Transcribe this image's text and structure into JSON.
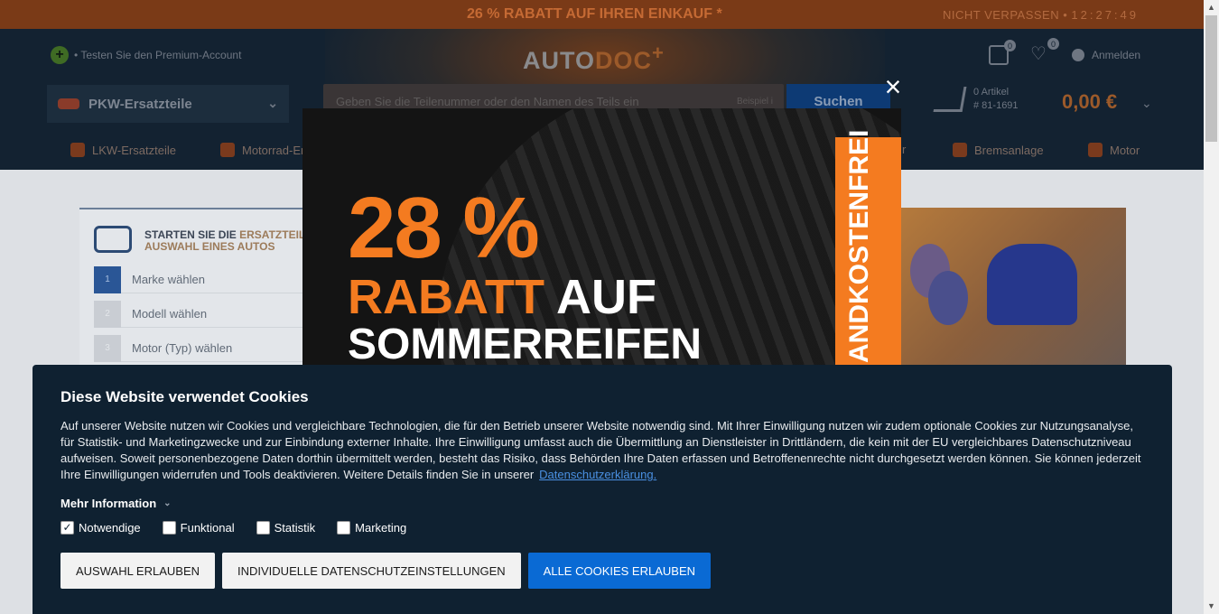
{
  "topbar": {
    "promo": "26 % RABATT AUF IHREN EINKAUF *",
    "countdown_label": "NICHT VERPASSEN",
    "countdown": "12:27:49"
  },
  "header": {
    "premium": "• Testen Sie den Premium-Account",
    "logo_main": "AUTO",
    "logo_accent": "DOC",
    "logo_plus": "+",
    "badge_garage": "0",
    "badge_wishlist": "0",
    "login": "Anmelden",
    "category": "PKW-Ersatzteile",
    "search_placeholder": "Geben Sie die Teilenummer oder den Namen des Teils ein",
    "search_example": "Beispiel",
    "search_button": "Suchen",
    "cart_count": "0 Artikel",
    "cart_id": "# 81-1691",
    "cart_total": "0,00 €"
  },
  "nav": {
    "truck": "LKW-Ersatzteile",
    "moto": "Motorrad-Er",
    "filter": "r",
    "brakes": "Bremsanlage",
    "engine": "Motor"
  },
  "panel": {
    "title_a": "STARTEN SIE DIE ",
    "title_b": "ERSATZTEIL",
    "title_c": "AUSWAHL EINES AUTOS",
    "steps": [
      {
        "num": "1",
        "label": "Marke wählen"
      },
      {
        "num": "2",
        "label": "Modell wählen"
      },
      {
        "num": "3",
        "label": "Motor (Typ) wählen"
      }
    ]
  },
  "modal": {
    "percent": "28 %",
    "line2_a": "RABATT ",
    "line2_b": "AUF",
    "line3": "SOMMERREIFEN",
    "ribbon": "ANDKOSTENFREI"
  },
  "cookie": {
    "title": "Diese Website verwendet Cookies",
    "text": "Auf unserer Website nutzen wir Cookies und vergleichbare Technologien, die für den Betrieb unserer Website notwendig sind. Mit Ihrer Einwilligung nutzen wir zudem optionale Cookies zur Nutzungsanalyse, für Statistik- und Marketingzwecke und zur Einbindung externer Inhalte. Ihre Einwilligung umfasst auch die Übermittlung an Dienstleister in Drittländern, die kein mit der EU vergleichbares Datenschutzniveau aufweisen. Soweit personenbezogene Daten dorthin übermittelt werden, besteht das Risiko, dass Behörden Ihre Daten erfassen und Betroffenenrechte nicht durchgesetzt werden können. Sie können jederzeit Ihre Einwilligungen widerrufen und Tools deaktivieren. Weitere Details finden Sie in unserer",
    "link": "Datenschutzerklärung.",
    "more": "Mehr Information",
    "checks": [
      {
        "label": "Notwendige",
        "checked": true
      },
      {
        "label": "Funktional",
        "checked": false
      },
      {
        "label": "Statistik",
        "checked": false
      },
      {
        "label": "Marketing",
        "checked": false
      }
    ],
    "btn_selection": "AUSWAHL ERLAUBEN",
    "btn_individual": "INDIVIDUELLE DATENSCHUTZEINSTELLUNGEN",
    "btn_all": "ALLE COOKIES ERLAUBEN"
  },
  "colors": {
    "accent": "#f47b20",
    "primary_button": "#0a6ad4",
    "cookie_bg": "#0f2131"
  }
}
